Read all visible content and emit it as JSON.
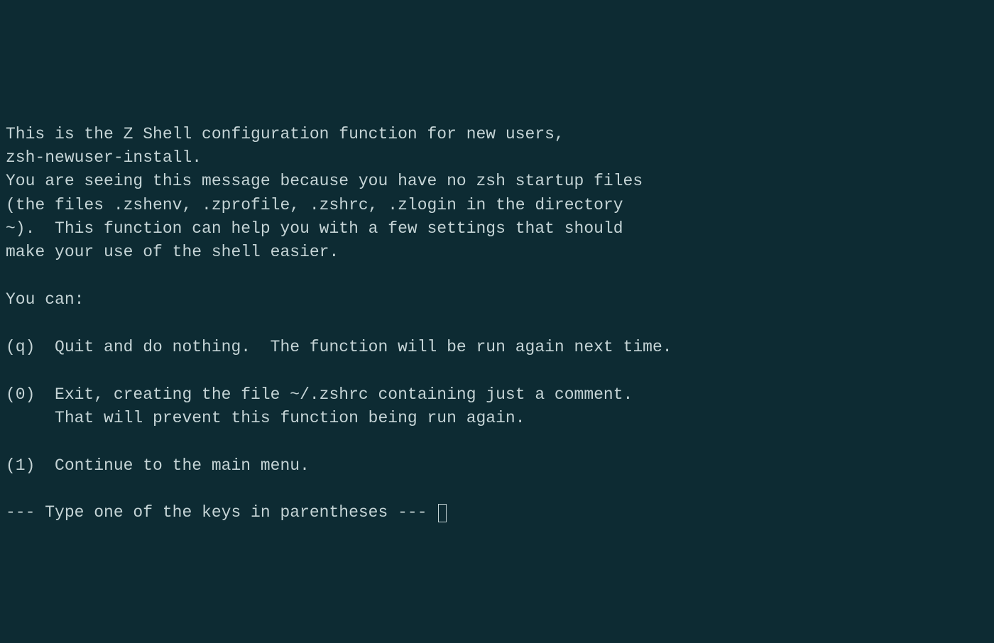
{
  "lines": {
    "l1": "This is the Z Shell configuration function for new users,",
    "l2": "zsh-newuser-install.",
    "l3": "You are seeing this message because you have no zsh startup files",
    "l4": "(the files .zshenv, .zprofile, .zshrc, .zlogin in the directory",
    "l5": "~).  This function can help you with a few settings that should",
    "l6": "make your use of the shell easier.",
    "l7": "",
    "l8": "You can:",
    "l9": "",
    "l10": "(q)  Quit and do nothing.  The function will be run again next time.",
    "l11": "",
    "l12": "(0)  Exit, creating the file ~/.zshrc containing just a comment.",
    "l13": "     That will prevent this function being run again.",
    "l14": "",
    "l15": "(1)  Continue to the main menu.",
    "l16": "",
    "prompt": "--- Type one of the keys in parentheses --- "
  }
}
